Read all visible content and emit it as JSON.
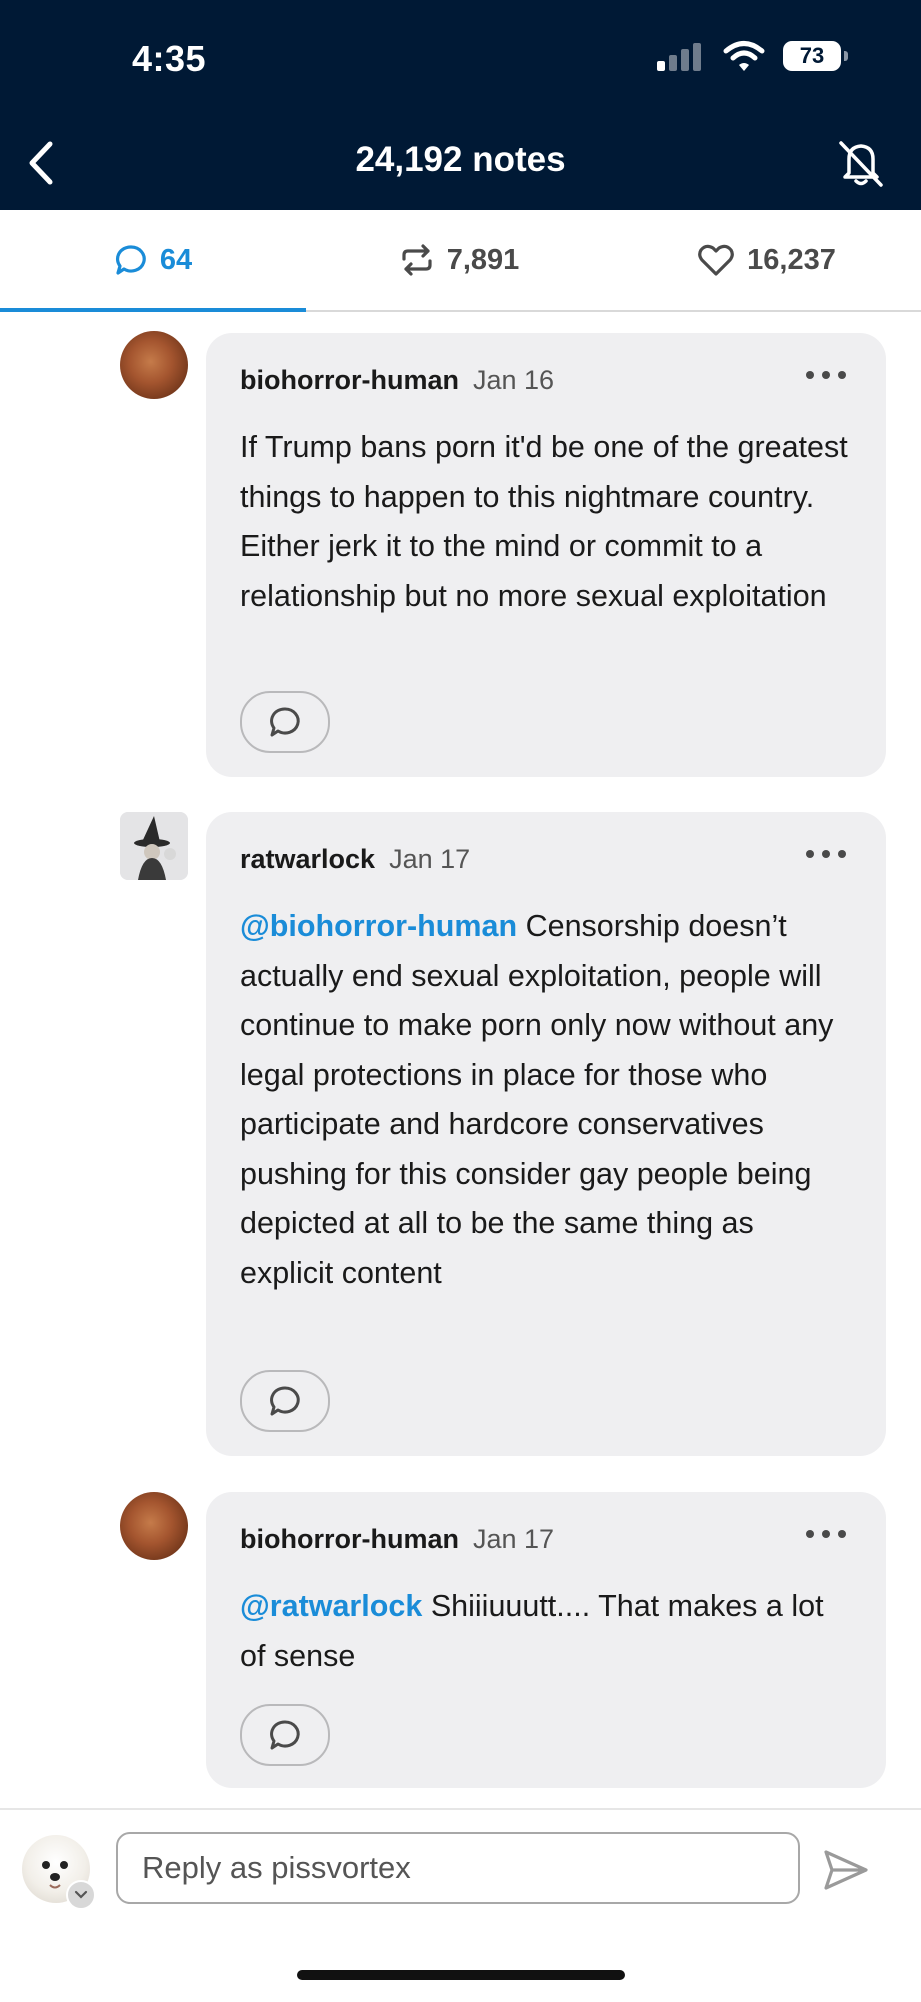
{
  "status_bar": {
    "time": "4:35",
    "battery": "73"
  },
  "nav": {
    "title": "24,192 notes"
  },
  "tabs": [
    {
      "label": "64",
      "icon": "comment-icon"
    },
    {
      "label": "7,891",
      "icon": "reblog-icon"
    },
    {
      "label": "16,237",
      "icon": "heart-icon"
    }
  ],
  "comments": [
    {
      "user": "biohorror-human",
      "date": "Jan 16",
      "mention": "",
      "text": "If Trump bans porn it'd be one of the greatest things to happen to this nightmare country. Either jerk it to the mind or commit to a relationship but no more sexual exploitation"
    },
    {
      "user": "ratwarlock",
      "date": "Jan 17",
      "mention": "@biohorror-human",
      "text": "Censorship doesn’t actually end sexual exploitation, people will continue to make porn only now without any legal protections in place for those who participate and hardcore conservatives pushing for this consider gay people being depicted at all to be the same thing as explicit content"
    },
    {
      "user": "biohorror-human",
      "date": "Jan 17",
      "mention": "@ratwarlock",
      "text": "Shiiiuuutt.... That makes a lot of sense"
    }
  ],
  "reply": {
    "placeholder": "Reply as pissvortex"
  },
  "colors": {
    "accent": "#1a8cd8",
    "header_bg": "#001935",
    "bubble_bg": "#efeff1"
  }
}
